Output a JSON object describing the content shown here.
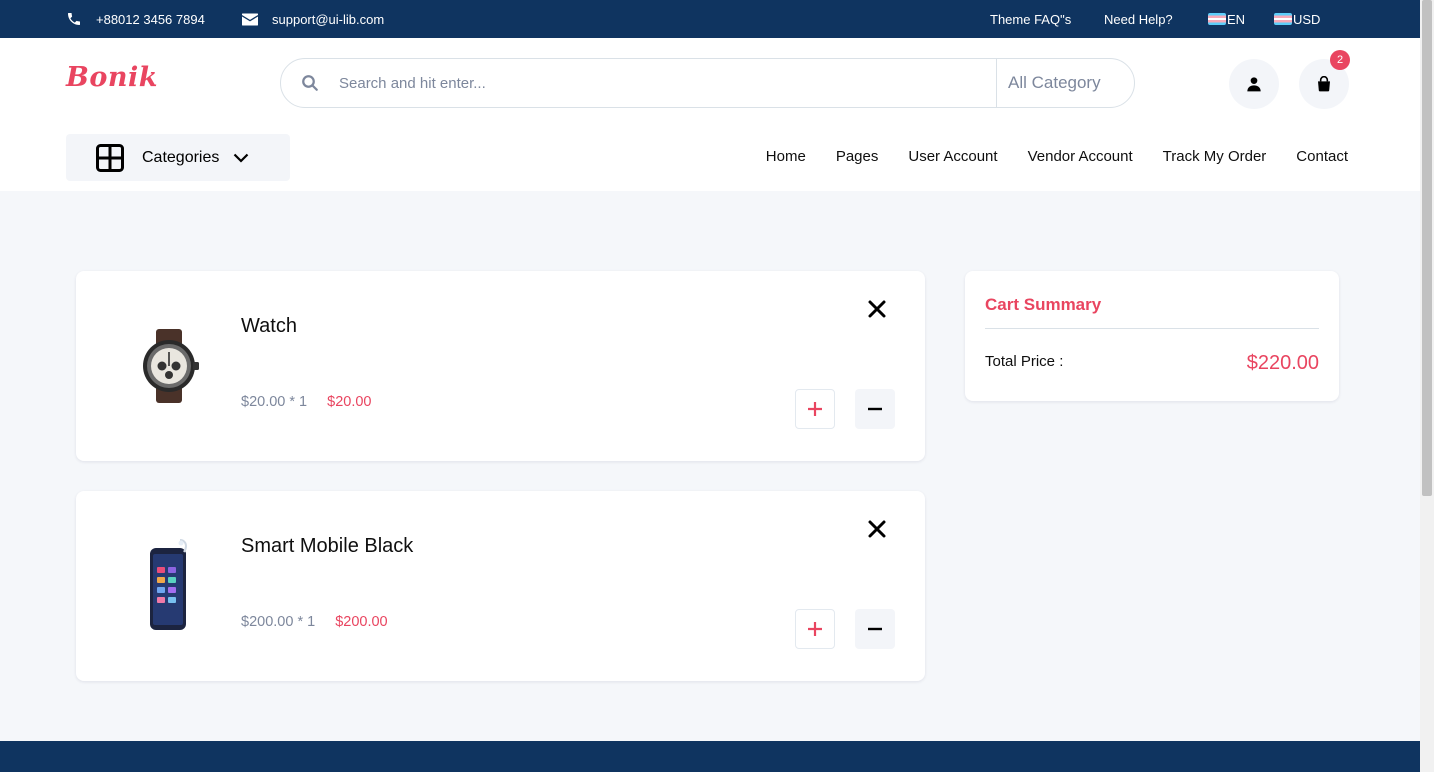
{
  "topbar": {
    "phone": "+88012 3456 7894",
    "email": "support@ui-lib.com",
    "faq": "Theme FAQ\"s",
    "help": "Need Help?",
    "language": "EN",
    "currency": "USD",
    "icons": [
      "phone-icon",
      "mail-icon",
      "flag-icon"
    ]
  },
  "header": {
    "logo": "Bonik",
    "search": {
      "placeholder": "Search and hit enter...",
      "category": "All Category"
    },
    "cart_count": "2",
    "icons": [
      "search-icon",
      "user-icon",
      "shopping-bag-icon"
    ]
  },
  "navbar": {
    "categories_label": "Categories",
    "links": [
      "Home",
      "Pages",
      "User Account",
      "Vendor Account",
      "Track My Order",
      "Contact"
    ],
    "icons": [
      "grid-icon",
      "chevron-down-icon"
    ]
  },
  "cart": {
    "items": [
      {
        "name": "Watch",
        "unit_price": "$20.00 * 1",
        "total": "$20.00",
        "image": "watch"
      },
      {
        "name": "Smart Mobile Black",
        "unit_price": "$200.00 * 1",
        "total": "$200.00",
        "image": "smartphone"
      }
    ],
    "icons": [
      "close-icon",
      "plus-icon",
      "minus-icon"
    ]
  },
  "summary": {
    "title": "Cart Summary",
    "total_label": "Total Price :",
    "total_value": "$220.00"
  },
  "colors": {
    "primary": "#e94560",
    "dark_blue": "#0f3460",
    "background": "#f5f7fa"
  }
}
